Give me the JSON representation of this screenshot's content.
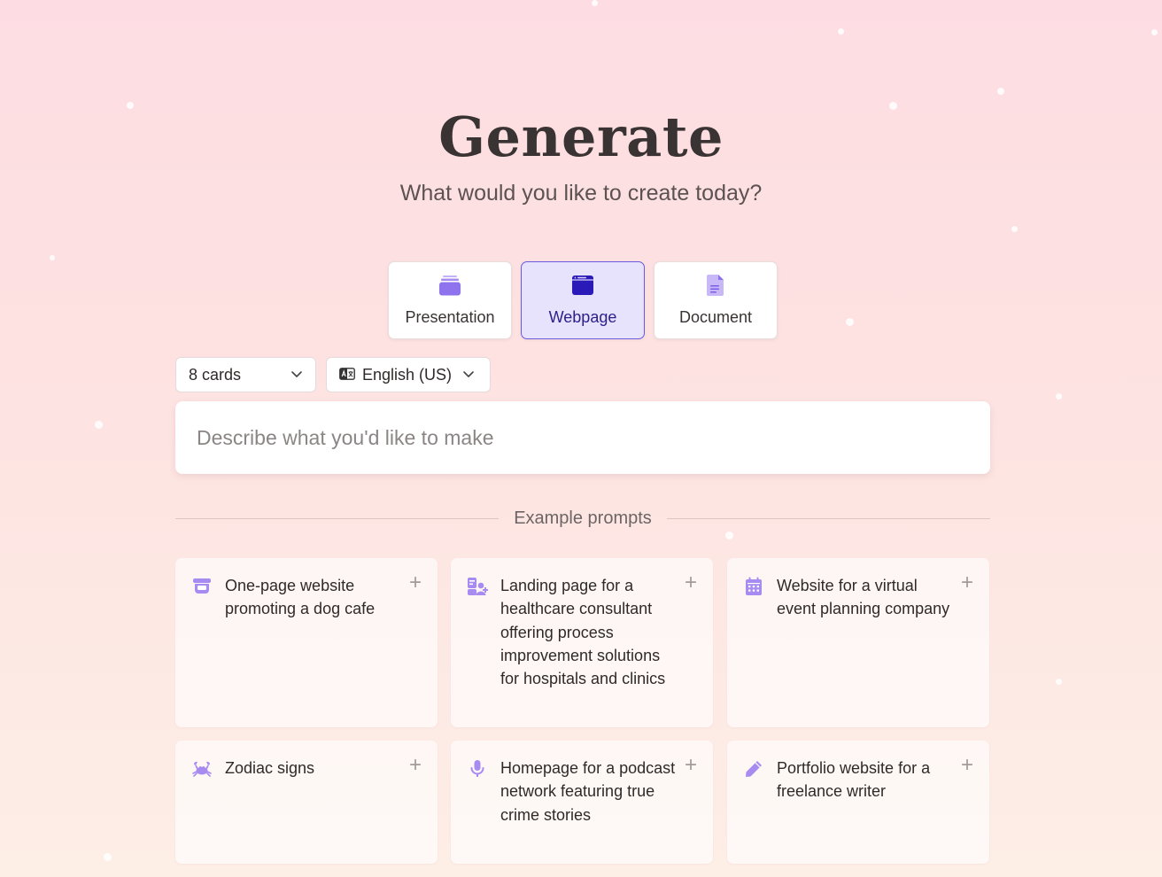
{
  "header": {
    "title": "Generate",
    "subtitle": "What would you like to create today?"
  },
  "types": [
    {
      "label": "Presentation",
      "icon": "presentation-icon",
      "active": false
    },
    {
      "label": "Webpage",
      "icon": "webpage-icon",
      "active": true
    },
    {
      "label": "Document",
      "icon": "document-icon",
      "active": false
    }
  ],
  "options": {
    "cards": "8 cards",
    "language": "English (US)"
  },
  "prompt": {
    "placeholder": "Describe what you'd like to make"
  },
  "examples": {
    "heading": "Example prompts",
    "items": [
      {
        "text": "One-page website promoting a dog cafe",
        "icon": "coffee-cup-icon"
      },
      {
        "text": "Landing page for a healthcare consultant offering process improvement solutions for hospitals and clinics",
        "icon": "medical-user-icon"
      },
      {
        "text": "Website for a virtual event planning company",
        "icon": "calendar-icon"
      },
      {
        "text": "Zodiac signs",
        "icon": "crab-icon"
      },
      {
        "text": "Homepage for a podcast network featuring true crime stories",
        "icon": "microphone-icon"
      },
      {
        "text": "Portfolio website for a freelance writer",
        "icon": "pencil-icon"
      }
    ]
  },
  "colors": {
    "accent": "#6a5ae0",
    "icon": "#a78bf0",
    "active_bg": "#e8e3fd"
  }
}
